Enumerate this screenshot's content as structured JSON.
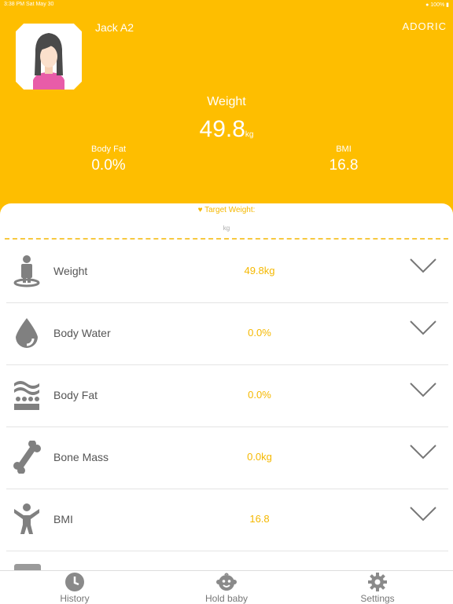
{
  "status_bar": {
    "time_date": "3:38 PM  Sat May 30",
    "battery": "100%"
  },
  "header": {
    "user_name": "Jack A2",
    "brand": "ADORIC",
    "weight_label": "Weight",
    "weight_value": "49.8",
    "weight_unit": "kg",
    "body_fat_label": "Body Fat",
    "body_fat_value": "0.0%",
    "bmi_label": "BMI",
    "bmi_value": "16.8"
  },
  "target": {
    "label": "Target Weight:",
    "unit": "kg"
  },
  "metrics": [
    {
      "name": "Weight",
      "value": "49.8kg",
      "icon": "person-on-scale-icon"
    },
    {
      "name": "Body Water",
      "value": "0.0%",
      "icon": "water-drop-icon"
    },
    {
      "name": "Body Fat",
      "value": "0.0%",
      "icon": "fat-layer-icon"
    },
    {
      "name": "Bone Mass",
      "value": "0.0kg",
      "icon": "bone-icon"
    },
    {
      "name": "BMI",
      "value": "16.8",
      "icon": "person-arms-up-icon"
    }
  ],
  "tabs": [
    {
      "label": "History",
      "icon": "clock-icon"
    },
    {
      "label": "Hold baby",
      "icon": "baby-face-icon"
    },
    {
      "label": "Settings",
      "icon": "gear-icon"
    }
  ],
  "colors": {
    "accent": "#FEBE00",
    "value_text": "#F5B800",
    "icon_gray": "#808080"
  }
}
